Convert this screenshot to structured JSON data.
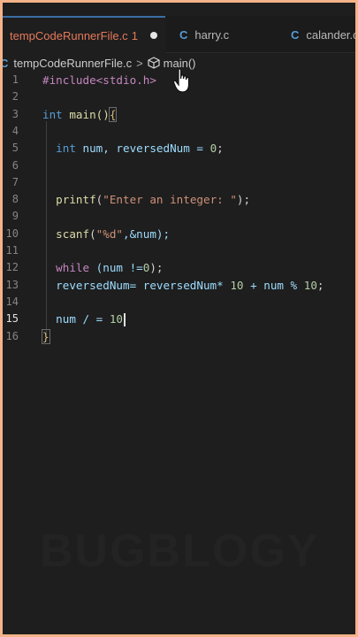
{
  "tabs": [
    {
      "label": "tempCodeRunnerFile.c",
      "badge": "1",
      "active": true,
      "icon": "c-file-icon"
    },
    {
      "label": "harry.c",
      "active": false,
      "icon": "c-file-icon"
    },
    {
      "label": "calander.c",
      "active": false,
      "icon": "c-file-icon"
    }
  ],
  "breadcrumb": {
    "icon": "C",
    "file": "tempCodeRunnerFile.c",
    "separator": ">",
    "symbol": "main()"
  },
  "editor": {
    "active_line": "15",
    "lines": [
      {
        "n": "1",
        "parts": [
          {
            "t": "#include<stdio.h>",
            "c": "pp"
          }
        ]
      },
      {
        "n": "2",
        "parts": []
      },
      {
        "n": "3",
        "parts": [
          {
            "t": "int",
            "c": "kw"
          },
          {
            "t": " main()",
            "c": "fn"
          },
          {
            "t": "{",
            "c": "brace"
          }
        ]
      },
      {
        "n": "4",
        "parts": []
      },
      {
        "n": "5",
        "parts": [
          {
            "t": "  int",
            "c": "kw"
          },
          {
            "t": " num, reversedNum = ",
            "c": "var"
          },
          {
            "t": "0",
            "c": "num"
          },
          {
            "t": ";",
            "c": ""
          }
        ]
      },
      {
        "n": "6",
        "parts": []
      },
      {
        "n": "7",
        "parts": []
      },
      {
        "n": "8",
        "parts": [
          {
            "t": "  printf",
            "c": "fn"
          },
          {
            "t": "(",
            "c": ""
          },
          {
            "t": "\"Enter an integer: \"",
            "c": "str"
          },
          {
            "t": ");",
            "c": ""
          }
        ]
      },
      {
        "n": "9",
        "parts": []
      },
      {
        "n": "10",
        "parts": [
          {
            "t": "  scanf",
            "c": "fn"
          },
          {
            "t": "(",
            "c": ""
          },
          {
            "t": "\"%d\"",
            "c": "str"
          },
          {
            "t": ",&num);",
            "c": "var"
          }
        ]
      },
      {
        "n": "11",
        "parts": []
      },
      {
        "n": "12",
        "parts": [
          {
            "t": "  while",
            "c": "pp"
          },
          {
            "t": " (num !=",
            "c": "var"
          },
          {
            "t": "0",
            "c": "num"
          },
          {
            "t": ");",
            "c": ""
          }
        ]
      },
      {
        "n": "13",
        "parts": [
          {
            "t": "  reversedNum= reversedNum* ",
            "c": "var"
          },
          {
            "t": "10",
            "c": "num"
          },
          {
            "t": " + num % ",
            "c": "var"
          },
          {
            "t": "10",
            "c": "num"
          },
          {
            "t": ";",
            "c": ""
          }
        ]
      },
      {
        "n": "14",
        "parts": []
      },
      {
        "n": "15",
        "parts": [
          {
            "t": "  num / = ",
            "c": "var"
          },
          {
            "t": "10",
            "c": "num"
          }
        ]
      },
      {
        "n": "16",
        "parts": [
          {
            "t": "}",
            "c": "brace"
          }
        ]
      }
    ]
  },
  "watermark": "BUGBLOGY",
  "colors": {
    "background": "#1e1e1e",
    "border": "#f5b38a",
    "accent": "#e6795b",
    "c_icon": "#569cd6"
  }
}
